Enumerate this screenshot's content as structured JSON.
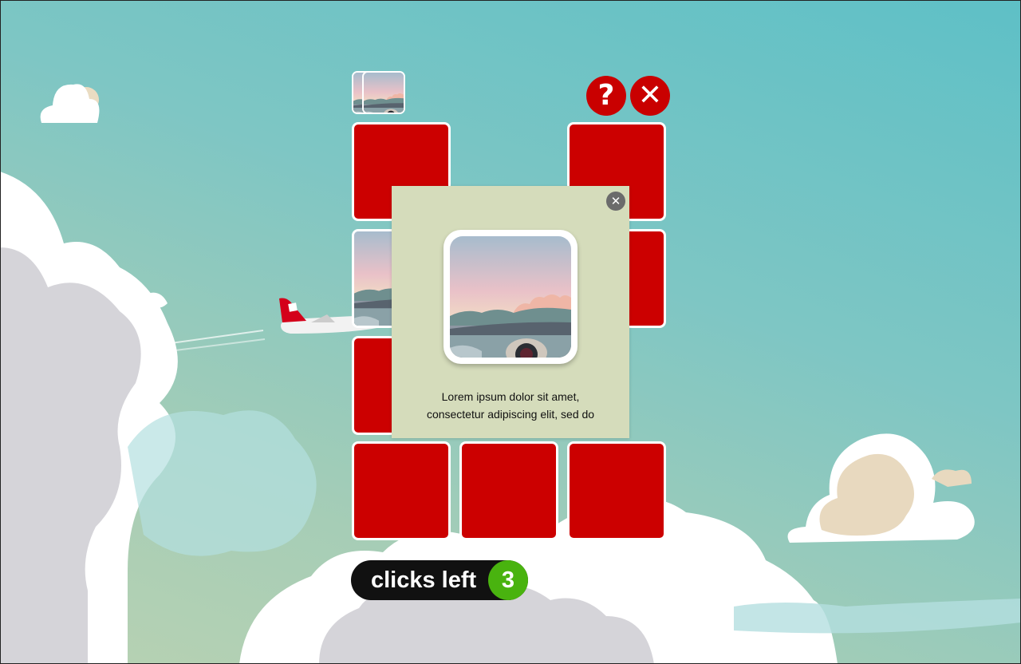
{
  "toolbar": {
    "help_icon": "question-mark-icon",
    "help_glyph": "?",
    "close_icon": "close-x-icon",
    "close_glyph": "✕"
  },
  "board": {
    "tile_color": "#cc0000",
    "revealed_image": "airplane-window-view",
    "matched_pairs_image": "airplane-window-view"
  },
  "popup": {
    "close_glyph": "✕",
    "image": "airplane-window-view",
    "text_line1": "Lorem ipsum dolor sit amet,",
    "text_line2": "consectetur adipiscing elit, sed do"
  },
  "clicks": {
    "label": "clicks left",
    "count": "3",
    "badge_color": "#49b30f"
  },
  "colors": {
    "accent_red": "#c90000",
    "popup_bg": "#d5dcbb"
  }
}
